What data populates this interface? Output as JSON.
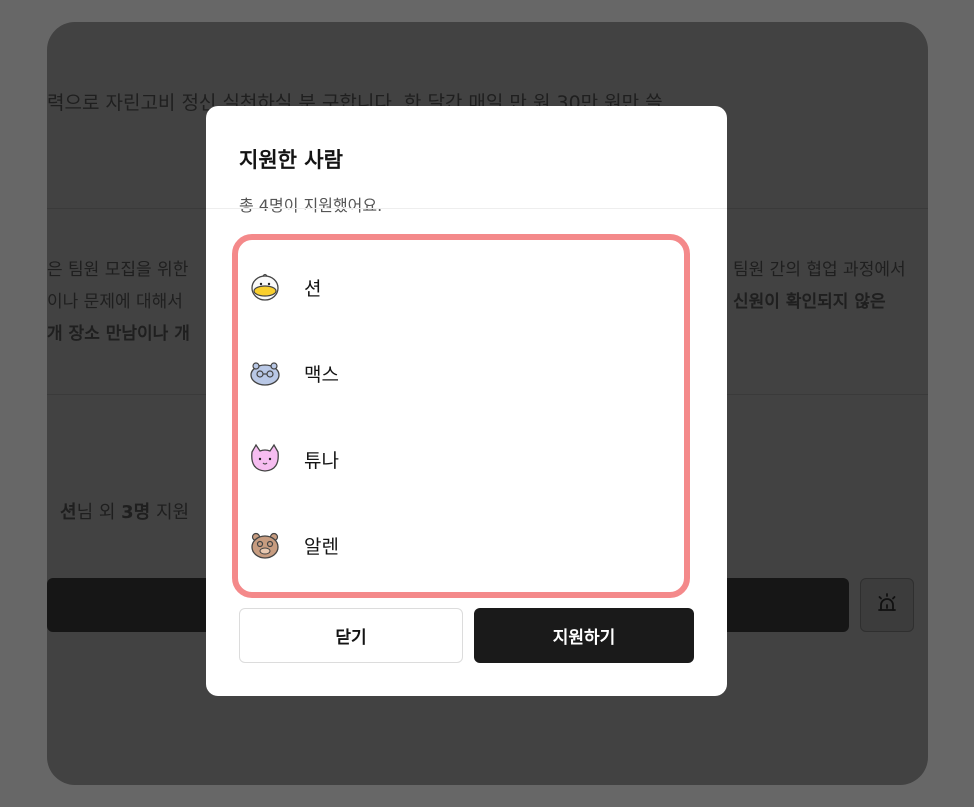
{
  "background": {
    "description_line": "력으로 자린고비 정신 실천하실 분 구합니다. 한 달간 매일 만 원 30만 원만 쓸",
    "para_left": [
      "은 팀원 모집을 위한",
      "이나 문제에 대해서",
      "개 장소 만남이나 개"
    ],
    "para_right": [
      "팀원 간의 협업 과정에서",
      "신원이 확인되지 않은"
    ],
    "applicants_summary": {
      "lead": "션",
      "mid": "님 외 ",
      "count": "3명",
      "tail": " 지원"
    },
    "report_icon": "siren-icon"
  },
  "modal": {
    "title": "지원한 사람",
    "subtitle": "총 4명이 지원했어요.",
    "applicants": [
      {
        "name": "션",
        "icon": "duck-avatar-icon"
      },
      {
        "name": "맥스",
        "icon": "hippo-avatar-icon"
      },
      {
        "name": "튜나",
        "icon": "cat-avatar-icon"
      },
      {
        "name": "알렌",
        "icon": "bear-avatar-icon"
      }
    ],
    "close_label": "닫기",
    "apply_label": "지원하기"
  },
  "colors": {
    "overlay": "#676767",
    "highlight_border": "#f4898a",
    "primary_button": "#1a1a1a"
  }
}
